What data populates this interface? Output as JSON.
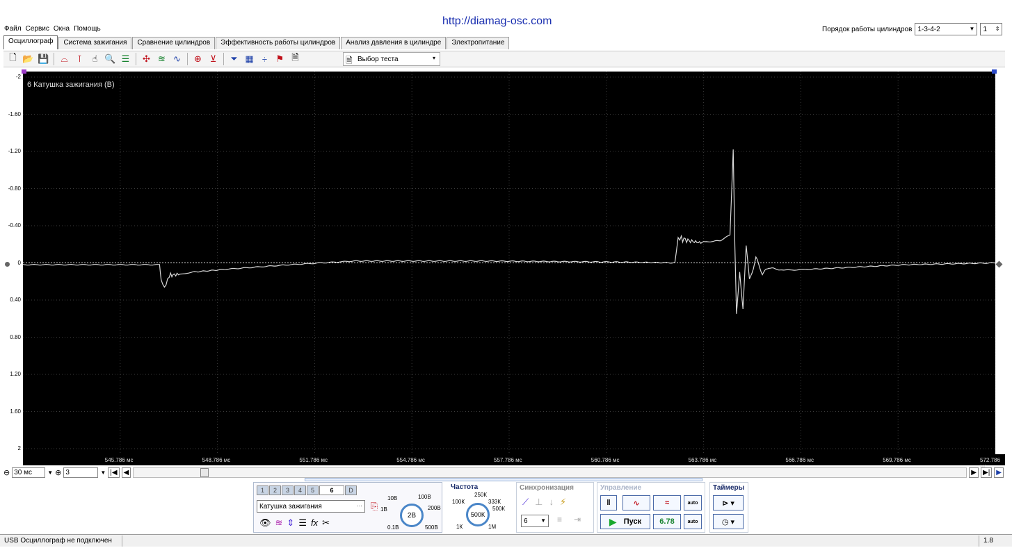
{
  "watermark": "http://diamag-osc.com",
  "menu": [
    "Файл",
    "Сервис",
    "Окна",
    "Помощь"
  ],
  "cylinder_order": {
    "label": "Порядок работы цилиндров",
    "value": "1-3-4-2",
    "cylinder": "1"
  },
  "tabs": [
    "Осциллограф",
    "Система зажигания",
    "Сравнение цилиндров",
    "Эффективность работы цилиндров",
    "Анализ давления в цилиндре",
    "Электропитание"
  ],
  "active_tab": 0,
  "toolbar": {
    "test_select_label": "Выбор теста"
  },
  "channel_label": "6 Катушка зажигания (В)",
  "y_ticks": [
    "-2",
    "-1.60",
    "-1.20",
    "-0.80",
    "-0.40",
    "0",
    "0.40",
    "0.80",
    "1.20",
    "1.60",
    "2"
  ],
  "x_ticks": [
    "545.786 мс",
    "548.786 мс",
    "551.786 мс",
    "554.786 мс",
    "557.786 мс",
    "560.786 мс",
    "563.786 мс",
    "566.786 мс",
    "569.786 мс",
    "572.786 мс"
  ],
  "chart_data": {
    "type": "line",
    "ylabel": "6 Катушка зажигания (В)",
    "ylim": [
      2,
      -2
    ],
    "xlim": [
      542.786,
      572.786
    ],
    "grid": true,
    "series": [
      {
        "name": "6 Катушка зажигания (В)",
        "color": "#d8d8d8",
        "x": [
          542.786,
          545.0,
          547.0,
          547.05,
          547.15,
          547.3,
          547.5,
          548.0,
          549.0,
          551.0,
          553.0,
          557.0,
          561.0,
          562.9,
          563.0,
          563.1,
          563.3,
          563.5,
          563.7,
          564.3,
          564.6,
          564.7,
          564.75,
          564.8,
          564.9,
          565.0,
          565.1,
          565.2,
          565.4,
          565.6,
          565.8,
          566.2,
          567.0,
          570.0,
          572.786
        ],
        "y": [
          0.02,
          0.02,
          0.02,
          0.18,
          0.27,
          0.14,
          0.13,
          0.1,
          0.07,
          0.02,
          -0.02,
          -0.02,
          -0.01,
          0.0,
          -0.27,
          -0.26,
          -0.24,
          -0.23,
          -0.22,
          -0.24,
          -0.3,
          -1.22,
          -0.2,
          0.55,
          0.1,
          0.5,
          -0.2,
          0.2,
          -0.05,
          0.12,
          0.05,
          0.08,
          0.07,
          0.02,
          0.0
        ]
      }
    ]
  },
  "bottom_controls": {
    "timebase": "30 мс",
    "channel_count": "3"
  },
  "panel": {
    "channel_buttons": [
      "1",
      "2",
      "3",
      "4",
      "5",
      "6",
      "D"
    ],
    "active_channel": "6",
    "sensor": "Катушка зажигания",
    "range_labels": [
      "10В",
      "100В",
      "1В",
      "200В",
      "0.1В",
      "500В"
    ],
    "range_value": "2В",
    "frequency_title": "Частота",
    "freq_labels": [
      "250К",
      "100К",
      "333К",
      "500К",
      "1К",
      "1М"
    ],
    "freq_value": "500К",
    "sync_title": "Синхронизация",
    "sync_channel": "6",
    "control_title": "Управление",
    "run_label": "Пуск",
    "run_value": "6.78",
    "timers_title": "Таймеры",
    "auto_label": "auto"
  },
  "status": {
    "connection": "USB Осциллограф не подключен",
    "version": "1.8"
  },
  "colors": {
    "scope_bg": "#000000",
    "grid": "#3c3c3c",
    "trace": "#d8d8d8",
    "accent": "#1a2c6a"
  }
}
